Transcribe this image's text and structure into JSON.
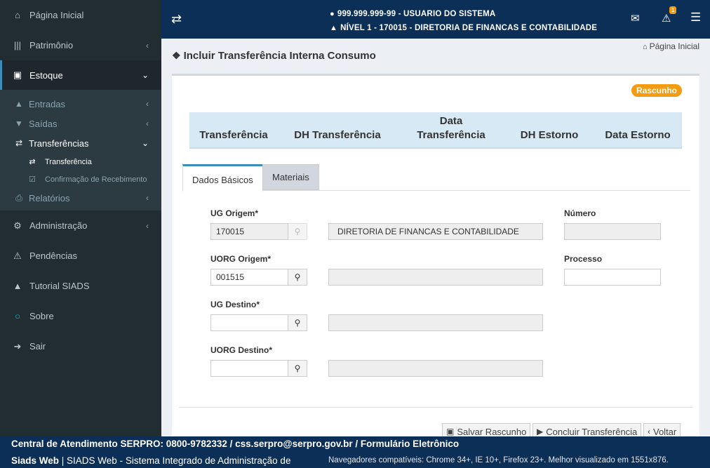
{
  "sidebar": {
    "items": [
      {
        "label": "Página Inicial",
        "icon": "home-icon"
      },
      {
        "label": "Patrimônio",
        "icon": "barcode-icon"
      },
      {
        "label": "Estoque",
        "icon": "box-icon"
      },
      {
        "label": "Administração",
        "icon": "gears-icon"
      },
      {
        "label": "Pendências",
        "icon": "warning-icon"
      },
      {
        "label": "Tutorial SIADS",
        "icon": "graduation-cap-icon"
      },
      {
        "label": "Sobre",
        "icon": "circle-icon"
      },
      {
        "label": "Sair",
        "icon": "sign-in-icon"
      }
    ],
    "estoque_sub": [
      {
        "label": "Entradas"
      },
      {
        "label": "Saídas"
      },
      {
        "label": "Transferências"
      },
      {
        "label": "Relatórios"
      }
    ],
    "transferencias_sub": [
      {
        "label": "Transferência"
      },
      {
        "label": "Confirmação de Recebimento"
      }
    ]
  },
  "header": {
    "user": "999.999.999-99 - USUARIO DO SISTEMA",
    "level": "NÍVEL 1 - 170015 - DIRETORIA DE FINANCAS E CONTABILIDADE",
    "alert_count": "1"
  },
  "page": {
    "title": "Incluir Transferência Interna Consumo",
    "breadcrumb": "Página Inicial",
    "status": "Rascunho",
    "columns": [
      "Transferência",
      "DH Transferência",
      "Data Transferência",
      "DH Estorno",
      "Data Estorno"
    ],
    "tabs": [
      "Dados Básicos",
      "Materiais"
    ]
  },
  "form": {
    "ug_origem_label": "UG Origem*",
    "ug_origem_value": "170015",
    "ug_origem_desc": "DIRETORIA DE FINANCAS E CONTABILIDADE",
    "numero_label": "Número",
    "uorg_origem_label": "UORG Origem*",
    "uorg_origem_value": "001515",
    "processo_label": "Processo",
    "ug_destino_label": "UG Destino*",
    "uorg_destino_label": "UORG Destino*"
  },
  "buttons": {
    "salvar": "Salvar Rascunho",
    "concluir": "Concluir Transferência",
    "voltar": "Voltar"
  },
  "footer": {
    "line1": "Central de Atendimento SERPRO: 0800-9782332 / css.serpro@serpro.gov.br / Formulário Eletrônico",
    "brand": "Siads Web",
    "line2": " | SIADS Web - Sistema Integrado de Administração de",
    "browsers": "Navegadores compatíveis: Chrome 34+, IE 10+, Firefox 23+. Melhor visualizado em 1551x876."
  }
}
